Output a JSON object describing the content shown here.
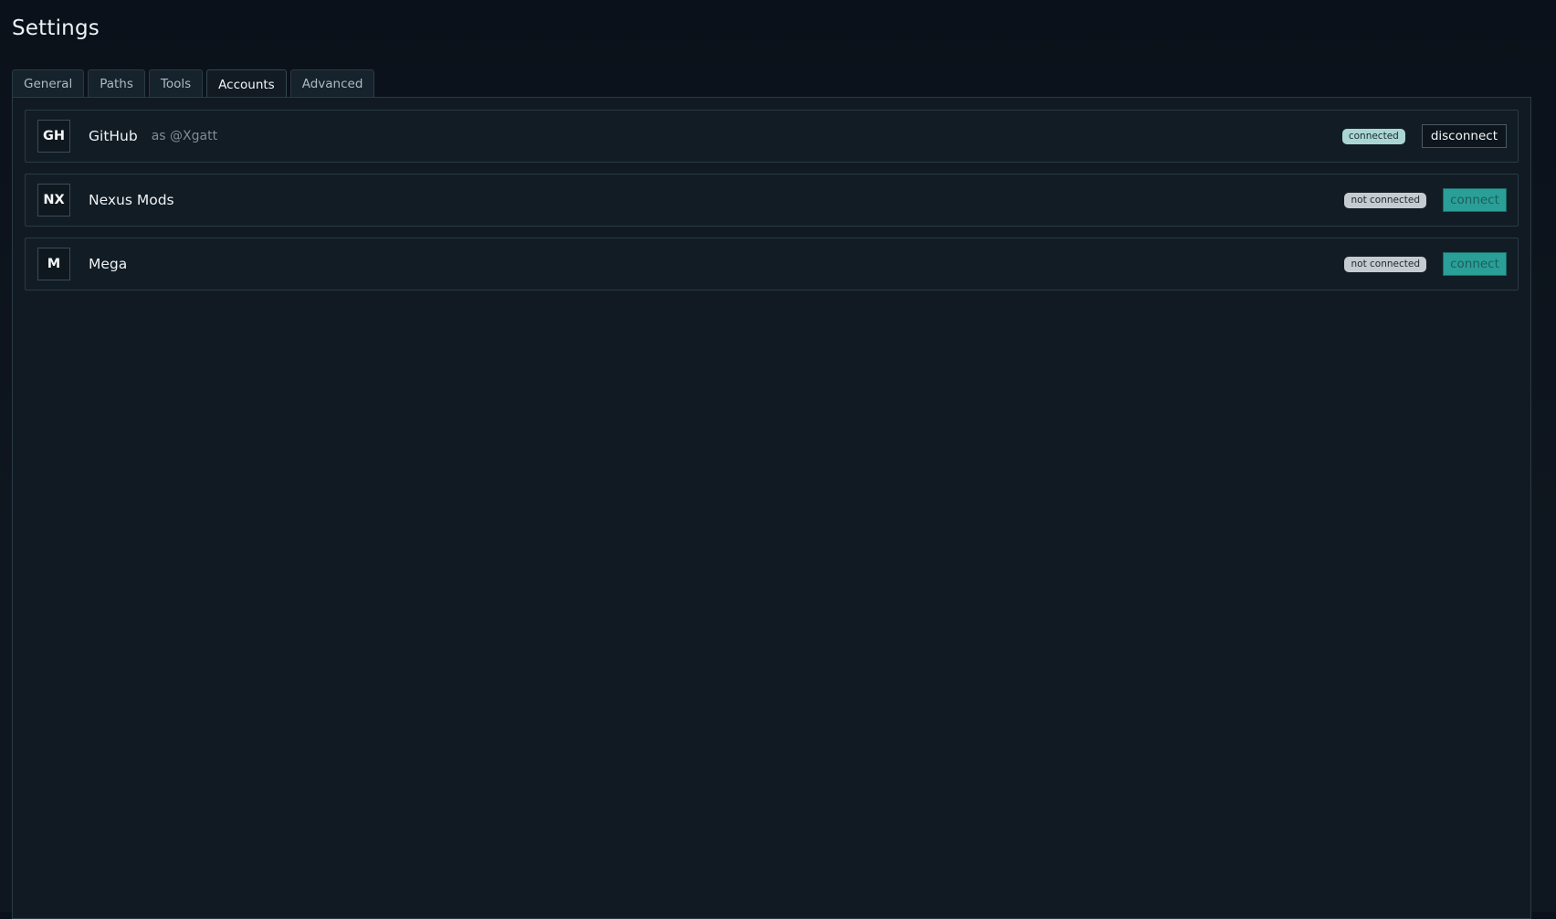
{
  "page": {
    "title": "Settings"
  },
  "tabs": [
    {
      "label": "General",
      "active": false
    },
    {
      "label": "Paths",
      "active": false
    },
    {
      "label": "Tools",
      "active": false
    },
    {
      "label": "Accounts",
      "active": true
    },
    {
      "label": "Advanced",
      "active": false
    }
  ],
  "accounts": [
    {
      "badge": "GH",
      "name": "GitHub",
      "user": "as @Xgatt",
      "status": "connected",
      "action": "disconnect"
    },
    {
      "badge": "NX",
      "name": "Nexus Mods",
      "user": "",
      "status": "not connected",
      "action": "connect"
    },
    {
      "badge": "M",
      "name": "Mega",
      "user": "",
      "status": "not connected",
      "action": "connect"
    }
  ],
  "colors": {
    "background": "#0e161f",
    "panel": "#111a22",
    "accent": "#2a9f98",
    "connected_badge": "#a9d6d3",
    "disconnected_badge": "#c6cbd0"
  }
}
